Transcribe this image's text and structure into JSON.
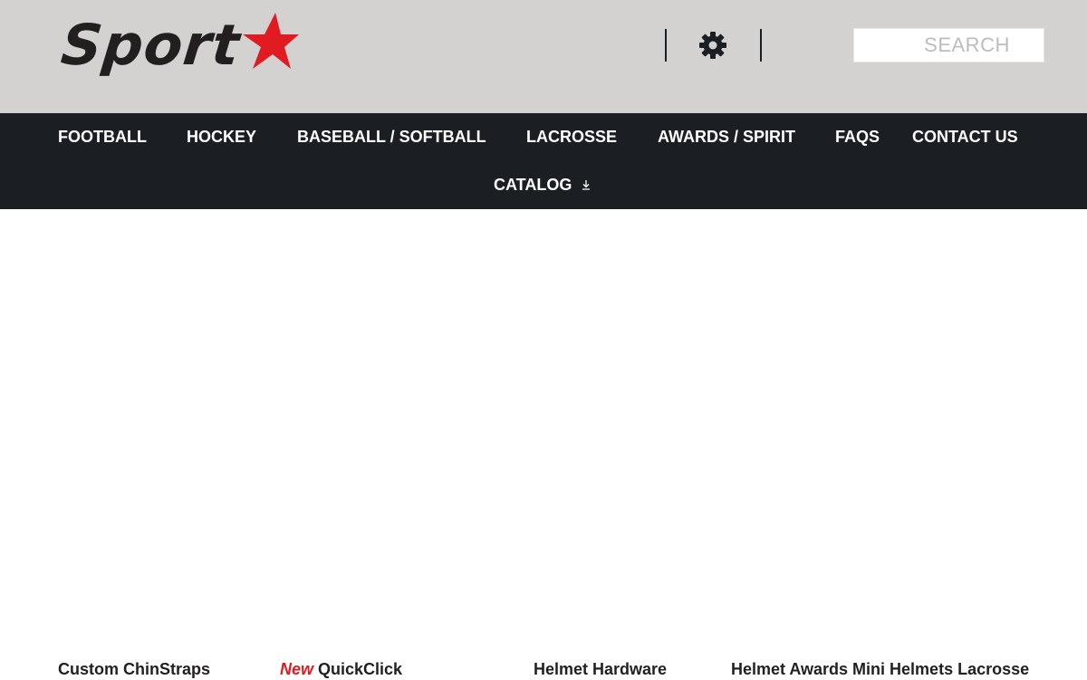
{
  "header": {
    "logo_text": "Sport",
    "brand_color": "#e11b22",
    "settings_icon": "gear-icon",
    "search": {
      "placeholder": "SEARCH",
      "value": ""
    }
  },
  "nav": {
    "items": [
      {
        "label": "FOOTBALL"
      },
      {
        "label": "HOCKEY"
      },
      {
        "label": "BASEBALL / SOFTBALL"
      },
      {
        "label": "LACROSSE"
      },
      {
        "label": "AWARDS / SPIRIT"
      },
      {
        "label": "FAQS"
      },
      {
        "label": "CONTACT US"
      },
      {
        "label": "CATALOG",
        "icon": "download-icon"
      }
    ]
  },
  "products": [
    {
      "title": "Custom ChinStraps"
    },
    {
      "badge": "New",
      "title": "QuickClick"
    },
    {
      "title": "Helmet Hardware"
    },
    {
      "title": "Helmet Awards Mini Helmets Lacrosse"
    }
  ]
}
